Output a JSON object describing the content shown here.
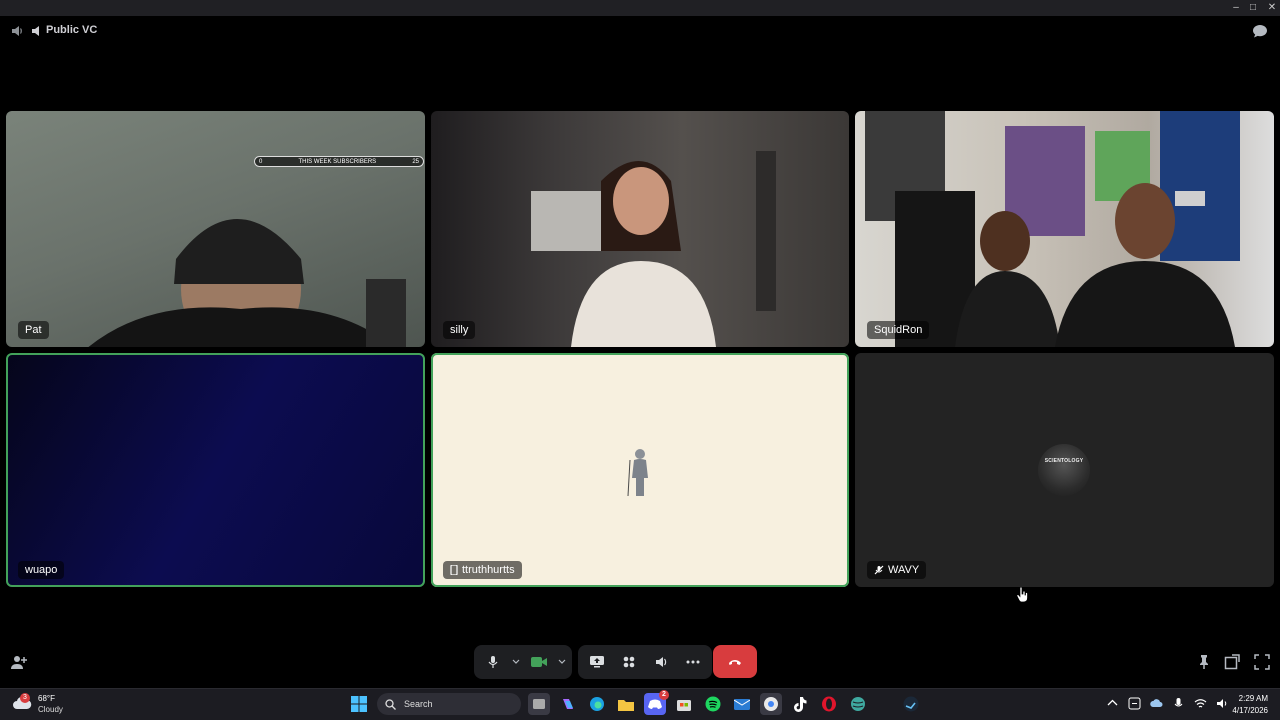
{
  "channel": {
    "name": "Public VC"
  },
  "tiles": [
    {
      "name": "Pat",
      "overlay_left": "0",
      "overlay_title": "THIS WEEK SUBSCRIBERS",
      "overlay_right": "25"
    },
    {
      "name": "silly"
    },
    {
      "name": "SquidRon"
    },
    {
      "name": "wuapo"
    },
    {
      "name": "ttruthhurtts"
    },
    {
      "name": "WAVY",
      "avatar_text": "SCIENTOLOGY"
    }
  ],
  "taskbar": {
    "weather_temp": "68°F",
    "weather_desc": "Cloudy",
    "weather_badge": "3",
    "search_placeholder": "Search",
    "discord_badge": "2",
    "time": "2:29 AM",
    "date": "4/17/2026"
  }
}
